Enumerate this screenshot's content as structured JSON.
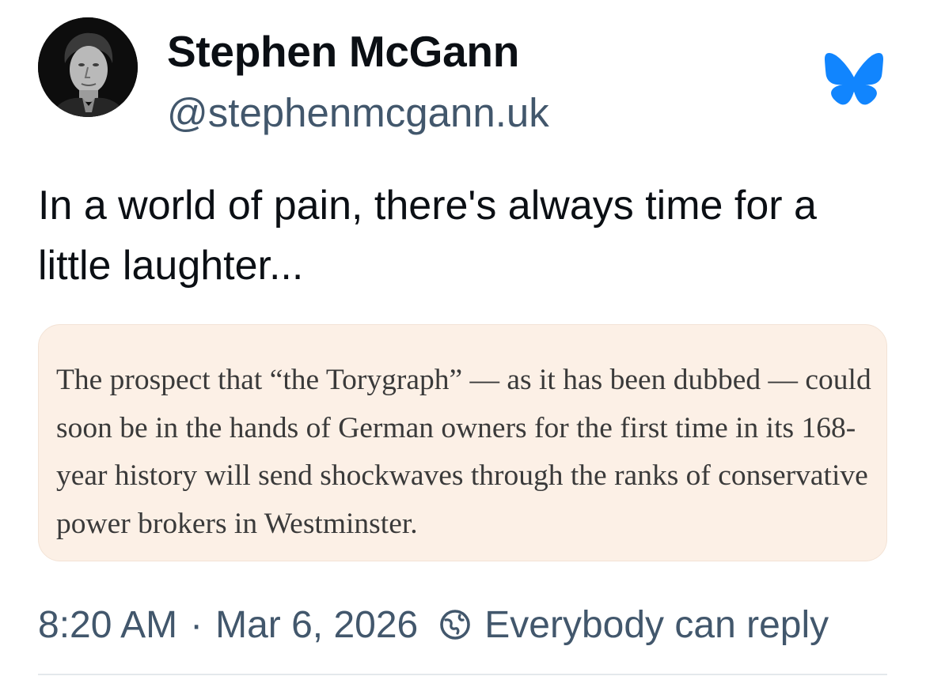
{
  "author": {
    "display_name": "Stephen McGann",
    "handle": "@stephenmcgann.uk",
    "avatar_icon": "profile-photo"
  },
  "brand": {
    "icon": "bluesky-butterfly-icon",
    "color": "#1185fe"
  },
  "post": {
    "text": "In a world of pain, there's always time for a little laughter..."
  },
  "quote": {
    "text": "The prospect that “the Torygraph” — as it has been dubbed — could soon be in the hands of German owners for the first time in its 168-year history will send shockwaves through the ranks of conservative power brokers in Westminster."
  },
  "meta": {
    "time": "8:20 AM",
    "separator": "·",
    "date": "Mar 6, 2026",
    "reply_icon": "reply-permission-icon",
    "reply_setting": "Everybody can reply"
  }
}
